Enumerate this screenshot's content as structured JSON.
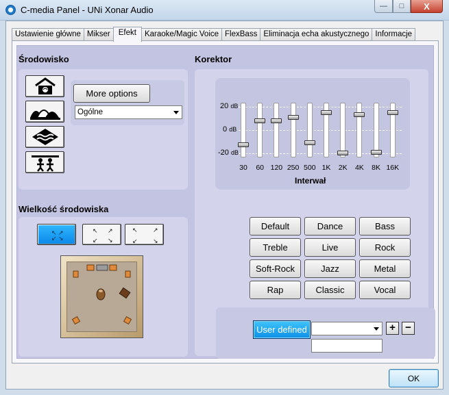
{
  "window": {
    "title": "C-media Panel - UNi Xonar Audio",
    "controls": {
      "minimize": "—",
      "maximize": "□",
      "close": "X"
    }
  },
  "tabs": [
    {
      "label": "Ustawienie główne"
    },
    {
      "label": "Mikser"
    },
    {
      "label": "Efekt"
    },
    {
      "label": "Karaoke/Magic Voice"
    },
    {
      "label": "FlexBass"
    },
    {
      "label": "Eliminacja echa akustycznego"
    },
    {
      "label": "Informacje"
    }
  ],
  "active_tab": "Efekt",
  "environment": {
    "heading": "Środowisko",
    "more_options_label": "More options",
    "selected": "Ogólne",
    "buttons": [
      {
        "icon": "house-icon"
      },
      {
        "icon": "opera-house-icon"
      },
      {
        "icon": "underwater-icon"
      },
      {
        "icon": "stage-performer-icon"
      }
    ]
  },
  "environment_size": {
    "heading": "Wielkość środowiska",
    "options": [
      "small",
      "medium",
      "large"
    ],
    "selected": "small"
  },
  "equalizer": {
    "heading": "Korektor",
    "db_labels": [
      {
        "value": "20",
        "unit": "dB"
      },
      {
        "value": "0",
        "unit": "dB"
      },
      {
        "value": "-20",
        "unit": "dB"
      }
    ],
    "band_axis_label": "Interwał",
    "bands": [
      {
        "freq": "30",
        "gain_db": -12
      },
      {
        "freq": "60",
        "gain_db": 8
      },
      {
        "freq": "120",
        "gain_db": 8
      },
      {
        "freq": "250",
        "gain_db": 11
      },
      {
        "freq": "500",
        "gain_db": -10
      },
      {
        "freq": "1K",
        "gain_db": 15
      },
      {
        "freq": "2K",
        "gain_db": -19
      },
      {
        "freq": "4K",
        "gain_db": 13
      },
      {
        "freq": "8K",
        "gain_db": -18
      },
      {
        "freq": "16K",
        "gain_db": 15
      }
    ],
    "presets": [
      "Default",
      "Dance",
      "Bass",
      "Treble",
      "Live",
      "Rock",
      "Soft-Rock",
      "Jazz",
      "Metal",
      "Rap",
      "Classic",
      "Vocal"
    ],
    "user_defined_label": "User defined",
    "user_preset_value": "",
    "user_preset_name": "",
    "add_label": "+",
    "remove_label": "−"
  },
  "footer": {
    "ok_label": "OK"
  },
  "colors": {
    "panel": "#c3c4e1",
    "active_button": "#1aa3f5"
  }
}
